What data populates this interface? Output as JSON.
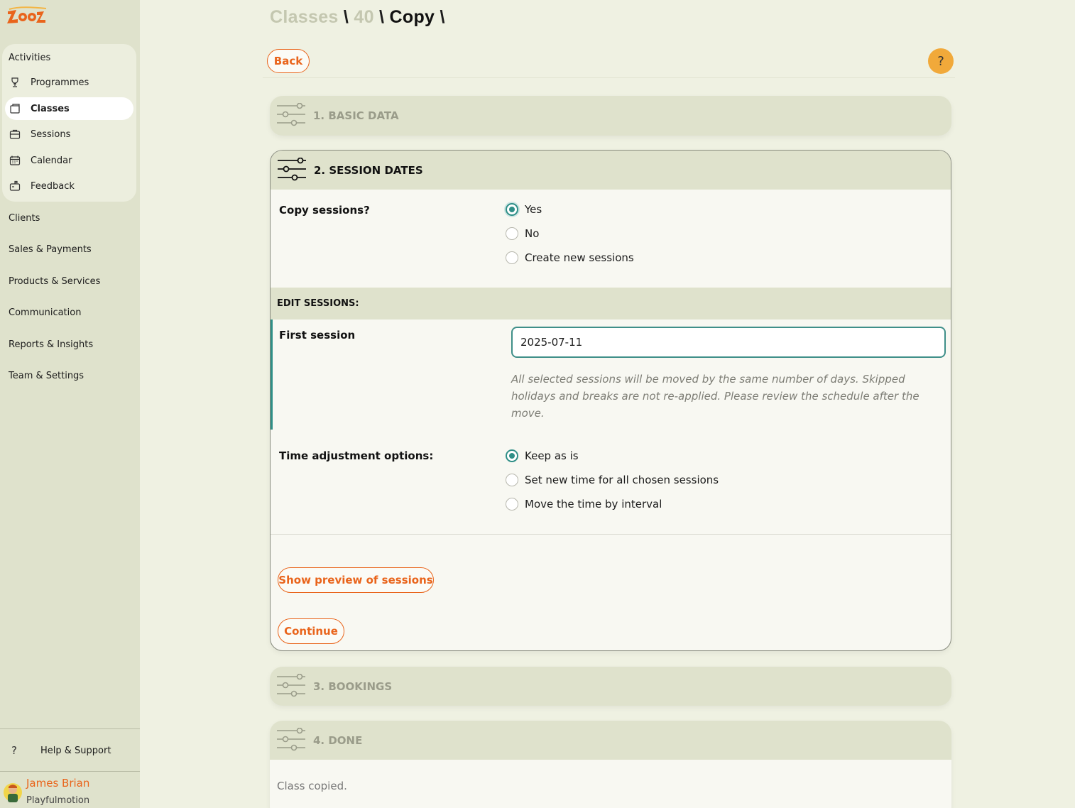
{
  "app": {
    "logo_text": "zooza",
    "brand_color": "#e9641b",
    "accent_color": "#2f8f87"
  },
  "sidebar": {
    "group_title": "Activities",
    "items": [
      {
        "label": "Programmes",
        "icon": "trophy-icon"
      },
      {
        "label": "Classes",
        "icon": "folder-icon",
        "active": true
      },
      {
        "label": "Sessions",
        "icon": "briefcase-icon"
      },
      {
        "label": "Calendar",
        "icon": "calendar-icon"
      },
      {
        "label": "Feedback",
        "icon": "mailbox-icon"
      }
    ],
    "main_items": [
      "Clients",
      "Sales & Payments",
      "Products & Services",
      "Communication",
      "Reports & Insights",
      "Team & Settings"
    ],
    "help_label": "Help & Support",
    "user": {
      "name": "James Brian",
      "org": "Playfulmotion"
    }
  },
  "breadcrumb": {
    "part1": "Classes",
    "sep1": " \\ ",
    "part2": "40",
    "sep2": " \\ ",
    "part3": "Copy",
    "sep3": " \\"
  },
  "toolbar": {
    "back_label": "Back",
    "help_label": "?"
  },
  "steps": [
    {
      "title": "1. BASIC DATA"
    },
    {
      "title": "2. SESSION DATES"
    },
    {
      "title": "3. BOOKINGS"
    },
    {
      "title": "4. DONE"
    }
  ],
  "session_dates": {
    "copy_label": "Copy sessions?",
    "copy_options": [
      "Yes",
      "No",
      "Create new sessions"
    ],
    "copy_selected": "Yes",
    "edit_title": "EDIT SESSIONS:",
    "first_session_label": "First session",
    "first_session_value": "2025-07-11",
    "hint": "All selected sessions will be moved by the same number of days. Skipped holidays and breaks are not re-applied. Please review the schedule after the move.",
    "time_label": "Time adjustment options:",
    "time_options": [
      "Keep as is",
      "Set new time for all chosen sessions",
      "Move the time by interval"
    ],
    "time_selected": "Keep as is",
    "preview_label": "Show preview of sessions",
    "continue_label": "Continue"
  },
  "done": {
    "message": "Class copied."
  }
}
